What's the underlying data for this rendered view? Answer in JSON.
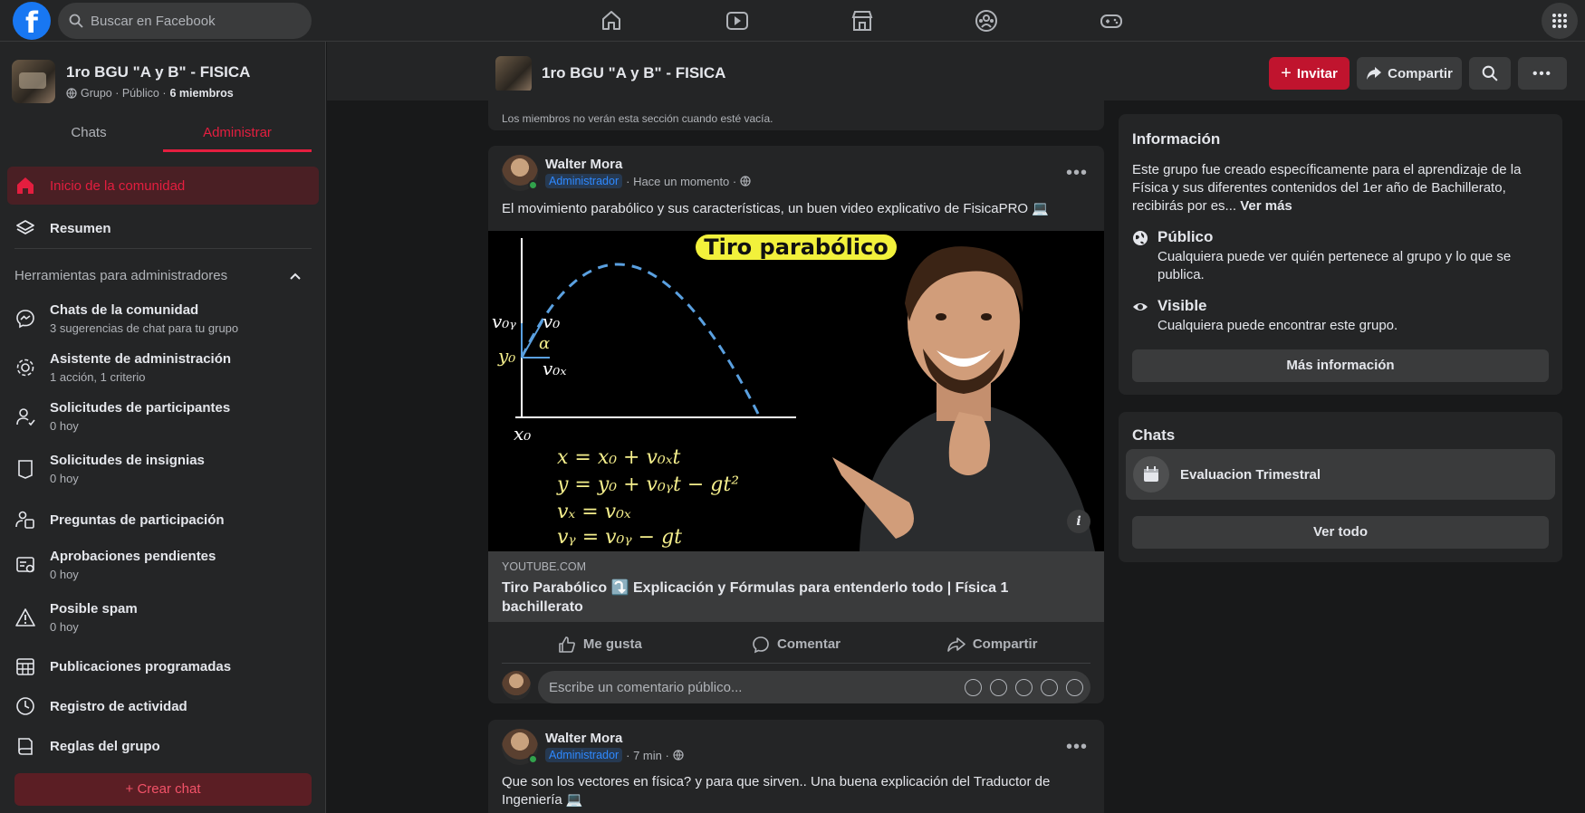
{
  "topbar": {
    "logo": "f",
    "search_placeholder": "Buscar en Facebook"
  },
  "group": {
    "name": "1ro BGU \"A y B\" - FISICA",
    "privacy": "Grupo · Público ·",
    "members": "6 miembros"
  },
  "sidebar": {
    "tabs": [
      {
        "label": "Chats"
      },
      {
        "label": "Administrar"
      }
    ],
    "home": {
      "label": "Inicio de la comunidad"
    },
    "summary": {
      "label": "Resumen"
    },
    "tools_header": "Herramientas para administradores",
    "items": [
      {
        "label": "Chats de la comunidad",
        "sub": "3 sugerencias de chat para tu grupo"
      },
      {
        "label": "Asistente de administración",
        "sub": "1 acción, 1 criterio"
      },
      {
        "label": "Solicitudes de participantes",
        "sub": "0 hoy"
      },
      {
        "label": "Solicitudes de insignias",
        "sub": "0 hoy"
      },
      {
        "label": "Preguntas de participación",
        "sub": ""
      },
      {
        "label": "Aprobaciones pendientes",
        "sub": "0 hoy"
      },
      {
        "label": "Posible spam",
        "sub": "0 hoy"
      },
      {
        "label": "Publicaciones programadas",
        "sub": ""
      },
      {
        "label": "Registro de actividad",
        "sub": ""
      },
      {
        "label": "Reglas del grupo",
        "sub": ""
      }
    ],
    "create_chat": "Crear chat"
  },
  "header": {
    "invite": "Invitar",
    "share": "Compartir"
  },
  "feed": {
    "empty_note": "Los miembros no verán esta sección cuando esté vacía.",
    "post1": {
      "author": "Walter Mora",
      "badge": "Administrador",
      "time": "· Hace un momento ·",
      "text": "El movimiento parabólico y sus características, un buen video explicativo de FisicaPRO 💻",
      "thumb_title": "Tiro parabólico",
      "eq1": "x = x₀ + v₀ₓt",
      "eq2": "y = y₀ + v₀ᵧt − gt²",
      "eq3": "vₓ = v₀ₓ",
      "eq4": "vᵧ = v₀ᵧ − gt",
      "lbl_v0y": "v₀ᵧ",
      "lbl_v0": "v₀",
      "lbl_alpha": "α",
      "lbl_y0": "y₀",
      "lbl_v0x": "v₀ₓ",
      "lbl_x0": "x₀",
      "link_source": "YOUTUBE.COM",
      "link_title": "Tiro Parabólico ⤵️ Explicación y Fórmulas para entenderlo todo | Física 1 bachillerato",
      "like": "Me gusta",
      "comment": "Comentar",
      "share": "Compartir",
      "comment_placeholder": "Escribe un comentario público..."
    },
    "post2": {
      "author": "Walter Mora",
      "badge": "Administrador",
      "time": "· 7 min ·",
      "text": "Que son los vectores en física? y para que sirven.. Una buena explicación del Traductor de Ingeniería 💻"
    }
  },
  "info": {
    "title": "Información",
    "description": "Este grupo fue creado específicamente para el aprendizaje de la Física y sus diferentes contenidos del 1er año de Bachillerato, recibirás por es...",
    "see_more": "Ver más",
    "public_title": "Público",
    "public_desc": "Cualquiera puede ver quién pertenece al grupo y lo que se publica.",
    "visible_title": "Visible",
    "visible_desc": "Cualquiera puede encontrar este grupo.",
    "more_button": "Más información"
  },
  "chats": {
    "title": "Chats",
    "item": "Evaluacion Trimestral",
    "see_all": "Ver todo"
  },
  "colors": {
    "accent": "#e41e3f",
    "facebook_blue": "#1877f2",
    "background": "#18191a",
    "card": "#242526"
  }
}
